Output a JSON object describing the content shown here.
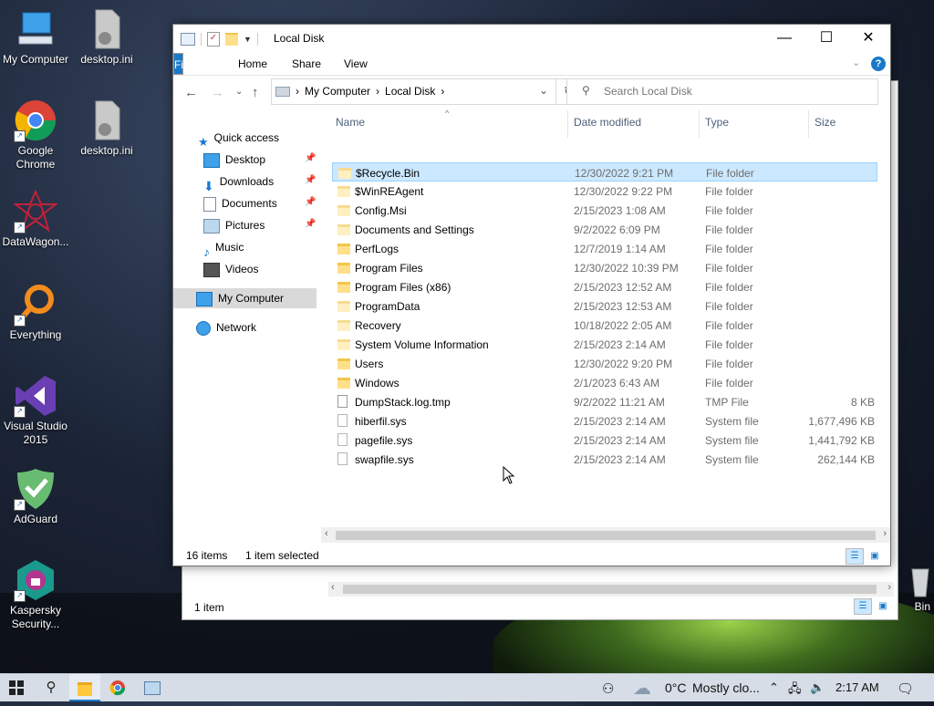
{
  "desktop": {
    "icons": [
      {
        "label": "My Computer"
      },
      {
        "label": "desktop.ini"
      },
      {
        "label": "Google Chrome"
      },
      {
        "label": "desktop.ini"
      },
      {
        "label": "DataWagon..."
      },
      {
        "label": "Everything"
      },
      {
        "label": "Visual Studio 2015"
      },
      {
        "label": "AdGuard"
      },
      {
        "label": "Kaspersky Security..."
      },
      {
        "label": "Bin"
      }
    ]
  },
  "back_window": {
    "status_left": "1 item"
  },
  "window": {
    "title": "Local Disk",
    "controls": {
      "minimize": "—",
      "maximize": "☐",
      "close": "✕"
    },
    "ribbon_tabs": [
      "File",
      "Home",
      "Share",
      "View"
    ],
    "address": {
      "crumbs": [
        "My Computer",
        "Local Disk"
      ],
      "separator": "›"
    },
    "search_placeholder": "Search Local Disk",
    "nav": {
      "quick_access": "Quick access",
      "items": [
        {
          "label": "Desktop",
          "pinned": true
        },
        {
          "label": "Downloads",
          "pinned": true
        },
        {
          "label": "Documents",
          "pinned": true
        },
        {
          "label": "Pictures",
          "pinned": true
        },
        {
          "label": "Music",
          "pinned": false
        },
        {
          "label": "Videos",
          "pinned": false
        }
      ],
      "my_computer": "My Computer",
      "network": "Network"
    },
    "columns": {
      "name": "Name",
      "date": "Date modified",
      "type": "Type",
      "size": "Size"
    },
    "files": [
      {
        "name": "$Recycle.Bin",
        "date": "12/30/2022 9:21 PM",
        "type": "File folder",
        "size": "",
        "kind": "folder-faded",
        "selected": true
      },
      {
        "name": "$WinREAgent",
        "date": "12/30/2022 9:22 PM",
        "type": "File folder",
        "size": "",
        "kind": "folder-faded",
        "selected": false
      },
      {
        "name": "Config.Msi",
        "date": "2/15/2023 1:08 AM",
        "type": "File folder",
        "size": "",
        "kind": "folder-faded",
        "selected": false
      },
      {
        "name": "Documents and Settings",
        "date": "9/2/2022 6:09 PM",
        "type": "File folder",
        "size": "",
        "kind": "folder-link",
        "selected": false
      },
      {
        "name": "PerfLogs",
        "date": "12/7/2019 1:14 AM",
        "type": "File folder",
        "size": "",
        "kind": "folder",
        "selected": false
      },
      {
        "name": "Program Files",
        "date": "12/30/2022 10:39 PM",
        "type": "File folder",
        "size": "",
        "kind": "folder",
        "selected": false
      },
      {
        "name": "Program Files (x86)",
        "date": "2/15/2023 12:52 AM",
        "type": "File folder",
        "size": "",
        "kind": "folder",
        "selected": false
      },
      {
        "name": "ProgramData",
        "date": "2/15/2023 12:53 AM",
        "type": "File folder",
        "size": "",
        "kind": "folder-faded",
        "selected": false
      },
      {
        "name": "Recovery",
        "date": "10/18/2022 2:05 AM",
        "type": "File folder",
        "size": "",
        "kind": "folder-faded",
        "selected": false
      },
      {
        "name": "System Volume Information",
        "date": "2/15/2023 2:14 AM",
        "type": "File folder",
        "size": "",
        "kind": "folder-faded",
        "selected": false
      },
      {
        "name": "Users",
        "date": "12/30/2022 9:20 PM",
        "type": "File folder",
        "size": "",
        "kind": "folder",
        "selected": false
      },
      {
        "name": "Windows",
        "date": "2/1/2023 6:43 AM",
        "type": "File folder",
        "size": "",
        "kind": "folder",
        "selected": false
      },
      {
        "name": "DumpStack.log.tmp",
        "date": "9/2/2022 11:21 AM",
        "type": "TMP File",
        "size": "8 KB",
        "kind": "file",
        "selected": false
      },
      {
        "name": "hiberfil.sys",
        "date": "2/15/2023 2:14 AM",
        "type": "System file",
        "size": "1,677,496 KB",
        "kind": "sys",
        "selected": false
      },
      {
        "name": "pagefile.sys",
        "date": "2/15/2023 2:14 AM",
        "type": "System file",
        "size": "1,441,792 KB",
        "kind": "sys",
        "selected": false
      },
      {
        "name": "swapfile.sys",
        "date": "2/15/2023 2:14 AM",
        "type": "System file",
        "size": "262,144 KB",
        "kind": "sys",
        "selected": false
      }
    ],
    "status": {
      "count": "16 items",
      "selection": "1 item selected"
    }
  },
  "taskbar": {
    "weather_temp": "0°C",
    "weather_text": "Mostly clo...",
    "time": "2:17 AM"
  },
  "colors": {
    "accent": "#1979ca",
    "selection": "#cce8ff",
    "folder": "#ffe08a"
  }
}
